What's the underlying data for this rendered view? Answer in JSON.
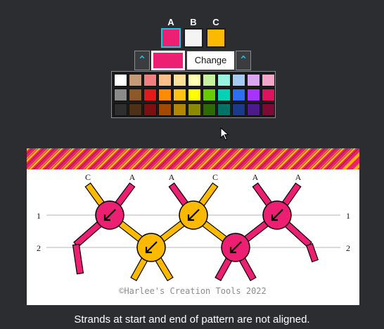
{
  "strands": {
    "items": [
      {
        "letter": "A",
        "color": "#ec1f73",
        "selected": true
      },
      {
        "letter": "B",
        "color": "#f4f4f4",
        "selected": false
      },
      {
        "letter": "C",
        "color": "#fbb900",
        "selected": false
      }
    ]
  },
  "controls": {
    "move_left_label": "^",
    "move_right_label": "^",
    "current_color": "#ec1f73",
    "change_label": "Change"
  },
  "palette": {
    "rows": [
      [
        "#ffffff",
        "#c49a78",
        "#f08080",
        "#ffbf8a",
        "#ffe099",
        "#ffffb3",
        "#c7f29c",
        "#99f2e0",
        "#a6cbf2",
        "#d9a6f2",
        "#f2a6c9"
      ],
      [
        "#8a8a8a",
        "#8b5a2b",
        "#e31a1c",
        "#ff8c00",
        "#ffc20e",
        "#ffff00",
        "#66cc00",
        "#00d2b4",
        "#2b6ff2",
        "#a633ff",
        "#e0115f"
      ],
      [
        "#2e2e2e",
        "#4d3015",
        "#7d0f0f",
        "#a34a00",
        "#b38600",
        "#8a8a00",
        "#2d6b00",
        "#007366",
        "#1a3a8c",
        "#4d1a8c",
        "#7d0a35"
      ]
    ]
  },
  "pattern": {
    "columns": [
      {
        "label": "C"
      },
      {
        "label": "A"
      },
      {
        "label": "A"
      },
      {
        "label": "C"
      },
      {
        "label": "A"
      },
      {
        "label": "A"
      }
    ],
    "row_labels": [
      "1",
      "2"
    ],
    "knots": [
      {
        "row": 1,
        "color": "#ec1f73",
        "direction": "down-left"
      },
      {
        "row": 1,
        "color": "#fbb900",
        "direction": "down-left"
      },
      {
        "row": 1,
        "color": "#ec1f73",
        "direction": "down-left"
      },
      {
        "row": 2,
        "color": "#fbb900",
        "direction": "down-left"
      },
      {
        "row": 2,
        "color": "#ec1f73",
        "direction": "down-left"
      }
    ],
    "band_colors": [
      "#ec1f73",
      "#fbb900"
    ],
    "copyright": "©Harlee's Creation Tools 2022"
  },
  "message": "Strands at start and end of pattern are not aligned."
}
